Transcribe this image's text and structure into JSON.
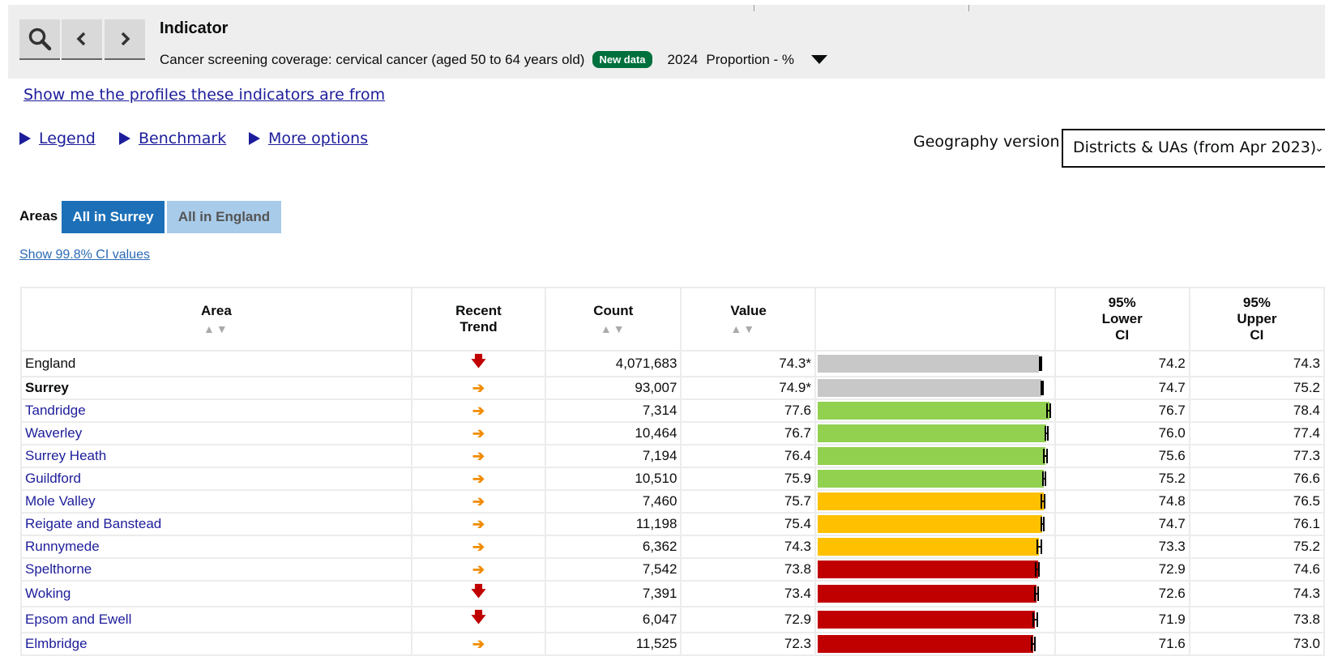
{
  "indicator": {
    "heading": "Indicator",
    "name": "Cancer screening coverage: cervical cancer (aged 50 to 64 years old)",
    "badge": "New data",
    "year": "2024",
    "unit": "Proportion - %"
  },
  "links": {
    "profiles": "Show me the profiles these indicators are from",
    "legend": "Legend",
    "benchmark": "Benchmark",
    "more_options": "More options",
    "ci_values": "Show 99.8% CI values"
  },
  "geography": {
    "label": "Geography version",
    "selected": "Districts & UAs (from Apr 2023)"
  },
  "areas": {
    "label": "Areas",
    "options": [
      "All in Surrey",
      "All in England"
    ],
    "active": "All in Surrey"
  },
  "table": {
    "headers": {
      "area": "Area",
      "trend": "Recent Trend",
      "count": "Count",
      "value": "Value",
      "lower": "95% Lower CI",
      "upper": "95% Upper CI"
    },
    "rows": [
      {
        "area": "England",
        "trend": "down",
        "count": "4,071,683",
        "value": "74.3*",
        "v": 74.3,
        "lo": "74.2",
        "hi": "74.3",
        "color": "#c8c8c8",
        "style": "plain"
      },
      {
        "area": "Surrey",
        "trend": "flat",
        "count": "93,007",
        "value": "74.9*",
        "v": 74.9,
        "lo": "74.7",
        "hi": "75.2",
        "color": "#c8c8c8",
        "style": "bold"
      },
      {
        "area": "Tandridge",
        "trend": "flat",
        "count": "7,314",
        "value": "77.6",
        "v": 77.6,
        "lo": "76.7",
        "hi": "78.4",
        "color": "#92d050",
        "style": "link"
      },
      {
        "area": "Waverley",
        "trend": "flat",
        "count": "10,464",
        "value": "76.7",
        "v": 76.7,
        "lo": "76.0",
        "hi": "77.4",
        "color": "#92d050",
        "style": "link"
      },
      {
        "area": "Surrey Heath",
        "trend": "flat",
        "count": "7,194",
        "value": "76.4",
        "v": 76.4,
        "lo": "75.6",
        "hi": "77.3",
        "color": "#92d050",
        "style": "link"
      },
      {
        "area": "Guildford",
        "trend": "flat",
        "count": "10,510",
        "value": "75.9",
        "v": 75.9,
        "lo": "75.2",
        "hi": "76.6",
        "color": "#92d050",
        "style": "link"
      },
      {
        "area": "Mole Valley",
        "trend": "flat",
        "count": "7,460",
        "value": "75.7",
        "v": 75.7,
        "lo": "74.8",
        "hi": "76.5",
        "color": "#ffc000",
        "style": "link"
      },
      {
        "area": "Reigate and Banstead",
        "trend": "flat",
        "count": "11,198",
        "value": "75.4",
        "v": 75.4,
        "lo": "74.7",
        "hi": "76.1",
        "color": "#ffc000",
        "style": "link"
      },
      {
        "area": "Runnymede",
        "trend": "flat",
        "count": "6,362",
        "value": "74.3",
        "v": 74.3,
        "lo": "73.3",
        "hi": "75.2",
        "color": "#ffc000",
        "style": "link"
      },
      {
        "area": "Spelthorne",
        "trend": "flat",
        "count": "7,542",
        "value": "73.8",
        "v": 73.8,
        "lo": "72.9",
        "hi": "74.6",
        "color": "#c00000",
        "style": "link"
      },
      {
        "area": "Woking",
        "trend": "down",
        "count": "7,391",
        "value": "73.4",
        "v": 73.4,
        "lo": "72.6",
        "hi": "74.3",
        "color": "#c00000",
        "style": "link"
      },
      {
        "area": "Epsom and Ewell",
        "trend": "down",
        "count": "6,047",
        "value": "72.9",
        "v": 72.9,
        "lo": "71.9",
        "hi": "73.8",
        "color": "#c00000",
        "style": "link"
      },
      {
        "area": "Elmbridge",
        "trend": "flat",
        "count": "11,525",
        "value": "72.3",
        "v": 72.3,
        "lo": "71.6",
        "hi": "73.0",
        "color": "#c00000",
        "style": "link"
      }
    ]
  },
  "icons": {
    "search": "search-icon",
    "back": "chevron-left-icon",
    "forward": "chevron-right-icon",
    "dropdown": "caret-down-icon",
    "trend_down": "arrow-down-icon",
    "trend_flat": "arrow-right-icon"
  }
}
